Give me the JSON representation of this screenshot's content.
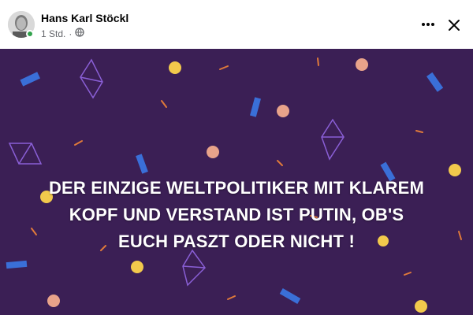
{
  "post": {
    "author_name": "Hans Karl Stöckl",
    "timestamp": "1 Std.",
    "separator": "·",
    "audience_icon": "globe-icon",
    "more_icon": "more-options-icon",
    "close_icon": "close-icon",
    "text_line_1": "DER EINZIGE WELTPOLITIKER MIT KLAREM",
    "text_line_2": "KOPF UND VERSTAND IST PUTIN, OB'S",
    "text_line_3": "EUCH PASZT ODER NICHT !",
    "background_color": "#3b1f55",
    "online_status_color": "#31a24c"
  }
}
